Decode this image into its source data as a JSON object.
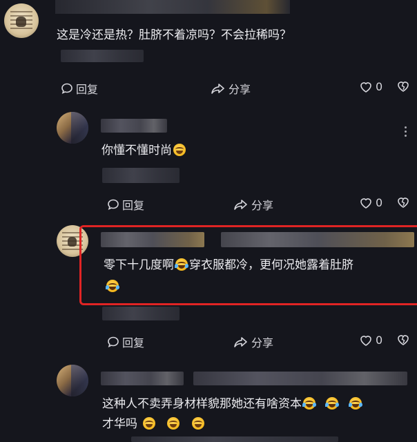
{
  "comments": [
    {
      "text": "这是冷还是热？肚脐不着凉吗？不会拉稀吗？",
      "reply_label": "回复",
      "share_label": "分享",
      "like_count": "0"
    },
    {
      "text": "你懂不懂时尚",
      "reply_label": "回复",
      "share_label": "分享",
      "like_count": "0"
    },
    {
      "text_part1": "零下十几度啊",
      "text_part2": "穿衣服都冷，更何况她露着肚脐",
      "reply_label": "回复",
      "share_label": "分享",
      "like_count": "0"
    },
    {
      "text_line1": "这种人不卖弄身材样貌那她还有啥资本",
      "text_line2": "才华吗"
    }
  ],
  "icons": {
    "reply": "comment-bubble-icon",
    "share": "share-arrow-icon",
    "like": "heart-icon",
    "dislike": "broken-heart-icon",
    "more": "more-vertical-icon",
    "emoji_grin": "grinning-sweat-emoji",
    "emoji_laugh": "tears-of-joy-emoji"
  },
  "colors": {
    "background": "#15161d",
    "text": "#ececf0",
    "highlight": "#e02424"
  }
}
